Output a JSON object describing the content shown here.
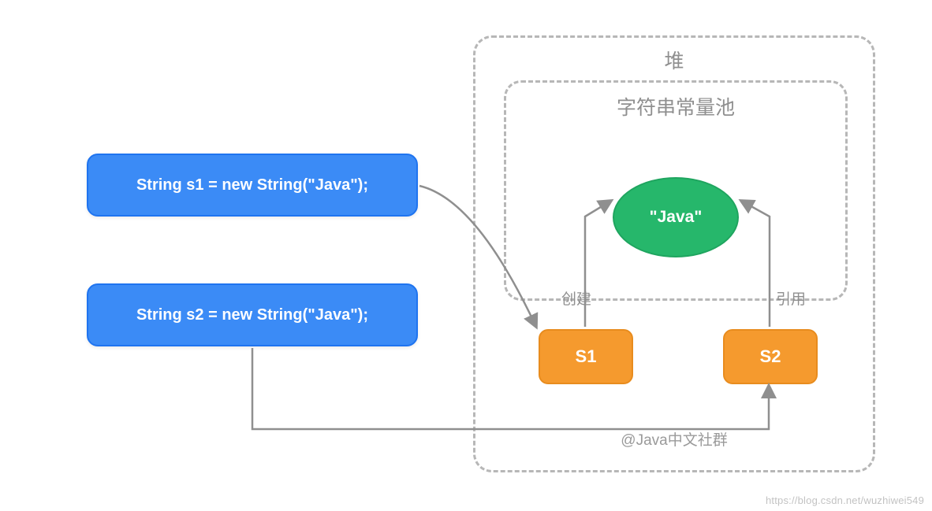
{
  "code": {
    "s1": "String s1 = new String(\"Java\");",
    "s2": "String s2 = new String(\"Java\");"
  },
  "heap": {
    "title": "堆",
    "pool_title": "字符串常量池",
    "pool_value": "\"Java\"",
    "obj_s1": "S1",
    "obj_s2": "S2",
    "label_create": "创建",
    "label_reference": "引用",
    "credit": "@Java中文社群"
  },
  "watermark": "https://blog.csdn.net/wuzhiwei549",
  "colors": {
    "code_bg": "#3b8bf6",
    "obj_bg": "#f59a2e",
    "ellipse_bg": "#26b76b",
    "dash": "#b7b7b7",
    "arrow": "#8f8f8f"
  },
  "chart_data": {
    "type": "diagram",
    "title": "Java String heap allocation with new String(\"Java\")",
    "nodes": [
      {
        "id": "code_s1",
        "label": "String s1 = new String(\"Java\");",
        "kind": "code"
      },
      {
        "id": "code_s2",
        "label": "String s2 = new String(\"Java\");",
        "kind": "code"
      },
      {
        "id": "heap",
        "label": "堆",
        "kind": "region"
      },
      {
        "id": "pool",
        "label": "字符串常量池",
        "kind": "region",
        "parent": "heap"
      },
      {
        "id": "literal",
        "label": "\"Java\"",
        "kind": "string_literal",
        "parent": "pool"
      },
      {
        "id": "obj_s1",
        "label": "S1",
        "kind": "heap_object",
        "parent": "heap"
      },
      {
        "id": "obj_s2",
        "label": "S2",
        "kind": "heap_object",
        "parent": "heap"
      }
    ],
    "edges": [
      {
        "from": "code_s1",
        "to": "obj_s1",
        "label": ""
      },
      {
        "from": "code_s2",
        "to": "obj_s2",
        "label": ""
      },
      {
        "from": "obj_s1",
        "to": "literal",
        "label": "创建"
      },
      {
        "from": "obj_s2",
        "to": "literal",
        "label": "引用"
      }
    ],
    "annotations": [
      "@Java中文社群"
    ]
  }
}
